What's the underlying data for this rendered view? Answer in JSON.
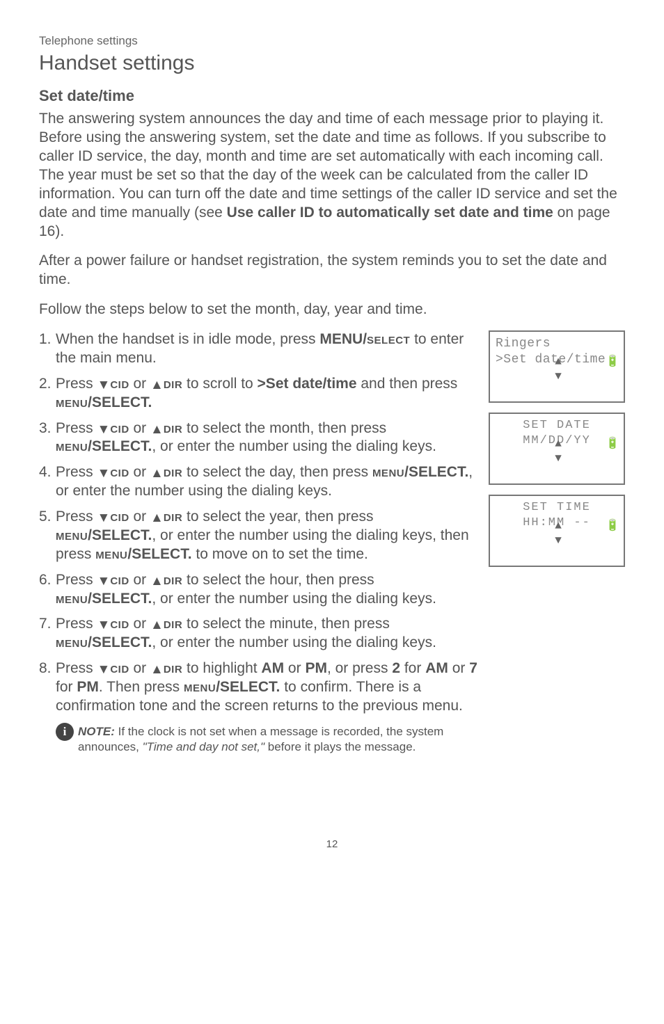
{
  "header": {
    "kicker": "Telephone settings",
    "title": "Handset settings"
  },
  "section_title": "Set date/time",
  "para1": "The answering system announces the day and time of each message prior to playing it. Before using the answering system, set the date and time as follows. If you subscribe to caller ID service, the day, month and time are set automatically with each incoming call. The year must be set so that the day of the week can be calculated from the caller ID information. You can turn off the date and time settings of the caller ID service and set the date and time manually (see ",
  "para1_bold": "Use caller ID to automatically set date and time",
  "para1_tail": " on page 16).",
  "para2": "After a power failure or handset registration, the system reminds you to set the date and time.",
  "para3": "Follow the steps below to set the month, day, year and time.",
  "steps": {
    "s1a": "When the handset is in idle mode, press ",
    "s1b": "MENU/",
    "s1c": "select",
    "s1d": " to enter the main menu.",
    "s2a": "Press ",
    "s2b": " or ",
    "s2c": " to scroll to ",
    "s2d": ">Set date/time",
    "s2e": " and then press ",
    "s2f": "/SELECT.",
    "s3a": " to select the month, then press ",
    "s3b": ", or enter the number using the dialing keys.",
    "s4a": " to select the day, then press ",
    "s5a": " to select the year, then press ",
    "s5b": ", or enter the number using the dialing keys, then press ",
    "s5c": " to move on to set the time.",
    "s6a": " to select the hour, then press ",
    "s7a": " to select the minute, then press ",
    "s8a": " to highlight ",
    "s8b": "AM",
    "s8c": " or ",
    "s8d": "PM",
    "s8e": ", or press ",
    "s8f": "2",
    "s8g": " for ",
    "s8h": "7",
    "s8i": ". Then press ",
    "s8j": " to confirm. There is a confirmation tone and the screen returns to the previous menu.",
    "cid": "cid",
    "dir": "dir",
    "menu": "menu"
  },
  "screens": {
    "a1": " Ringers",
    "a2": ">Set date/time",
    "b1": "SET DATE",
    "b2": "MM/DD/YY",
    "c1": "SET TIME",
    "c2": "HH:MM --"
  },
  "note": {
    "lead": "NOTE:",
    "body": " If the clock is not set when a message is recorded, the system announces, ",
    "quote": "\"Time and day not set,\"",
    "tail": " before it plays the message."
  },
  "page_number": "12"
}
